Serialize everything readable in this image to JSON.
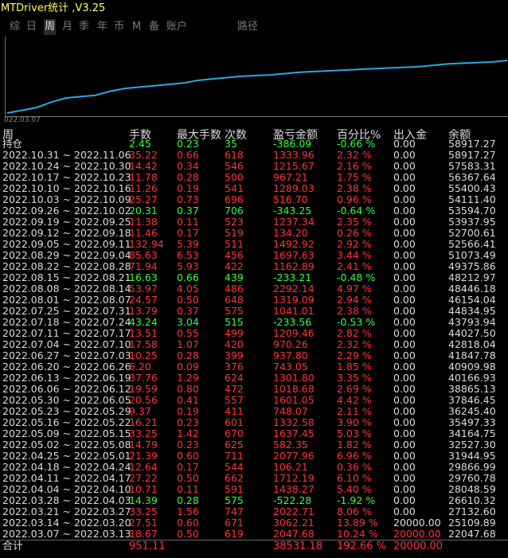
{
  "title": "MTDriver统计 ,V3.25",
  "tabs": [
    {
      "label": "综",
      "active": false
    },
    {
      "label": "日",
      "active": false
    },
    {
      "label": "周",
      "active": true
    },
    {
      "label": "月",
      "active": false
    },
    {
      "label": "季",
      "active": false
    },
    {
      "label": "年",
      "active": false
    },
    {
      "label": "币",
      "active": false
    },
    {
      "label": "M",
      "active": false
    },
    {
      "label": "备",
      "active": false
    },
    {
      "label": "账户",
      "active": false
    },
    {
      "label": "路径",
      "active": false
    }
  ],
  "chart": {
    "start_label": "022.03.07",
    "line_color": "#29a8e0",
    "values": [
      0,
      2,
      4,
      8,
      11,
      12,
      13,
      16,
      18,
      19,
      20,
      21,
      22,
      24,
      25,
      26,
      27,
      27.5,
      28,
      29,
      30,
      30.5,
      31,
      31.5,
      32,
      32.5,
      33,
      33.5,
      34,
      35,
      36,
      36.5,
      37,
      37.5,
      38.5
    ]
  },
  "headers": {
    "period": "周",
    "lots": "手数",
    "max_lots": "最大手数",
    "count": "次数",
    "profit": "盈亏金额",
    "percent": "百分比%",
    "inout": "出入金",
    "balance": "余额"
  },
  "position_row": {
    "label": "持仓",
    "lots": "2.45",
    "max": "0.23",
    "count": "35",
    "profit": "-386.09",
    "pct": "-0.66 %",
    "inout": "0.00",
    "balance": "58917.27"
  },
  "rows": [
    {
      "period": "2022.10.31 ~ 2022.11.06",
      "lots": "35.22",
      "max": "0.66",
      "count": "618",
      "profit": "1333.96",
      "pct": "2.32 %",
      "inout": "0.00",
      "balance": "58917.27",
      "pos": true
    },
    {
      "period": "2022.10.24 ~ 2022.10.30",
      "lots": "14.42",
      "max": "0.34",
      "count": "546",
      "profit": "1215.67",
      "pct": "2.16 %",
      "inout": "0.00",
      "balance": "57583.31",
      "pos": true
    },
    {
      "period": "2022.10.17 ~ 2022.10.23",
      "lots": "11.78",
      "max": "0.28",
      "count": "500",
      "profit": "967.21",
      "pct": "1.75 %",
      "inout": "0.00",
      "balance": "56367.64",
      "pos": true
    },
    {
      "period": "2022.10.10 ~ 2022.10.16",
      "lots": "11.26",
      "max": "0.19",
      "count": "541",
      "profit": "1289.03",
      "pct": "2.38 %",
      "inout": "0.00",
      "balance": "55400.43",
      "pos": true
    },
    {
      "period": "2022.10.03 ~ 2022.10.09",
      "lots": "25.27",
      "max": "0.73",
      "count": "696",
      "profit": "516.70",
      "pct": "0.96 %",
      "inout": "0.00",
      "balance": "54111.40",
      "pos": true
    },
    {
      "period": "2022.09.26 ~ 2022.10.02",
      "lots": "20.31",
      "max": "0.37",
      "count": "706",
      "profit": "-343.25",
      "pct": "-0.64 %",
      "inout": "0.00",
      "balance": "53594.70",
      "pos": false
    },
    {
      "period": "2022.09.19 ~ 2022.09.25",
      "lots": "11.38",
      "max": "0.11",
      "count": "523",
      "profit": "1237.34",
      "pct": "2.35 %",
      "inout": "0.00",
      "balance": "53937.95",
      "pos": true
    },
    {
      "period": "2022.09.12 ~ 2022.09.18",
      "lots": "11.46",
      "max": "0.17",
      "count": "519",
      "profit": "134.20",
      "pct": "0.26 %",
      "inout": "0.00",
      "balance": "52700.61",
      "pos": true
    },
    {
      "period": "2022.09.05 ~ 2022.09.11",
      "lots": "132.94",
      "max": "5.39",
      "count": "511",
      "profit": "1492.92",
      "pct": "2.92 %",
      "inout": "0.00",
      "balance": "52566.41",
      "pos": true
    },
    {
      "period": "2022.08.29 ~ 2022.09.04",
      "lots": "85.63",
      "max": "6.53",
      "count": "456",
      "profit": "1697.63",
      "pct": "3.44 %",
      "inout": "0.00",
      "balance": "51073.49",
      "pos": true
    },
    {
      "period": "2022.08.22 ~ 2022.08.28",
      "lots": "71.94",
      "max": "5.93",
      "count": "422",
      "profit": "1162.89",
      "pct": "2.41 %",
      "inout": "0.00",
      "balance": "49375.86",
      "pos": true
    },
    {
      "period": "2022.08.15 ~ 2022.08.21",
      "lots": "16.63",
      "max": "0.66",
      "count": "439",
      "profit": "-233.21",
      "pct": "-0.48 %",
      "inout": "0.00",
      "balance": "48212.97",
      "pos": false
    },
    {
      "period": "2022.08.08 ~ 2022.08.14",
      "lots": "53.97",
      "max": "4.05",
      "count": "486",
      "profit": "2292.14",
      "pct": "4.97 %",
      "inout": "0.00",
      "balance": "48446.18",
      "pos": true
    },
    {
      "period": "2022.08.01 ~ 2022.08.07",
      "lots": "24.57",
      "max": "0.50",
      "count": "648",
      "profit": "1319.09",
      "pct": "2.94 %",
      "inout": "0.00",
      "balance": "46154.04",
      "pos": true
    },
    {
      "period": "2022.07.25 ~ 2022.07.31",
      "lots": "13.79",
      "max": "0.37",
      "count": "575",
      "profit": "1041.01",
      "pct": "2.38 %",
      "inout": "0.00",
      "balance": "44834.95",
      "pos": true
    },
    {
      "period": "2022.07.18 ~ 2022.07.24",
      "lots": "43.24",
      "max": "3.04",
      "count": "515",
      "profit": "-233.56",
      "pct": "-0.53 %",
      "inout": "0.00",
      "balance": "43793.94",
      "pos": false
    },
    {
      "period": "2022.07.11 ~ 2022.07.17",
      "lots": "13.51",
      "max": "0.55",
      "count": "499",
      "profit": "1209.46",
      "pct": "2.82 %",
      "inout": "0.00",
      "balance": "44027.50",
      "pos": true
    },
    {
      "period": "2022.07.04 ~ 2022.07.10",
      "lots": "17.58",
      "max": "1.07",
      "count": "420",
      "profit": "970.26",
      "pct": "2.32 %",
      "inout": "0.00",
      "balance": "42818.04",
      "pos": true
    },
    {
      "period": "2022.06.27 ~ 2022.07.03",
      "lots": "10.25",
      "max": "0.28",
      "count": "399",
      "profit": "937.80",
      "pct": "2.29 %",
      "inout": "0.00",
      "balance": "41847.78",
      "pos": true
    },
    {
      "period": "2022.06.20 ~ 2022.06.26",
      "lots": "6.20",
      "max": "0.09",
      "count": "376",
      "profit": "743.05",
      "pct": "1.85 %",
      "inout": "0.00",
      "balance": "40909.98",
      "pos": true
    },
    {
      "period": "2022.06.13 ~ 2022.06.19",
      "lots": "37.76",
      "max": "1.29",
      "count": "624",
      "profit": "1301.80",
      "pct": "3.35 %",
      "inout": "0.00",
      "balance": "40166.93",
      "pos": true
    },
    {
      "period": "2022.06.06 ~ 2022.06.12",
      "lots": "19.59",
      "max": "0.80",
      "count": "472",
      "profit": "1018.68",
      "pct": "2.69 %",
      "inout": "0.00",
      "balance": "38865.13",
      "pos": true
    },
    {
      "period": "2022.05.30 ~ 2022.06.05",
      "lots": "20.56",
      "max": "0.41",
      "count": "557",
      "profit": "1601.05",
      "pct": "4.42 %",
      "inout": "0.00",
      "balance": "37846.45",
      "pos": true
    },
    {
      "period": "2022.05.23 ~ 2022.05.29",
      "lots": "9.37",
      "max": "0.19",
      "count": "411",
      "profit": "748.07",
      "pct": "2.11 %",
      "inout": "0.00",
      "balance": "36245.40",
      "pos": true
    },
    {
      "period": "2022.05.16 ~ 2022.05.22",
      "lots": "16.21",
      "max": "0.23",
      "count": "601",
      "profit": "1332.58",
      "pct": "3.90 %",
      "inout": "0.00",
      "balance": "35497.33",
      "pos": true
    },
    {
      "period": "2022.05.09 ~ 2022.05.15",
      "lots": "33.25",
      "max": "1.42",
      "count": "670",
      "profit": "1637.45",
      "pct": "5.03 %",
      "inout": "0.00",
      "balance": "34164.75",
      "pos": true
    },
    {
      "period": "2022.05.02 ~ 2022.05.08",
      "lots": "14.79",
      "max": "0.23",
      "count": "625",
      "profit": "582.35",
      "pct": "1.82 %",
      "inout": "0.00",
      "balance": "32527.30",
      "pos": true
    },
    {
      "period": "2022.04.25 ~ 2022.05.01",
      "lots": "21.39",
      "max": "0.60",
      "count": "711",
      "profit": "2077.96",
      "pct": "6.96 %",
      "inout": "0.00",
      "balance": "31944.95",
      "pos": true
    },
    {
      "period": "2022.04.18 ~ 2022.04.24",
      "lots": "12.64",
      "max": "0.17",
      "count": "544",
      "profit": "106.21",
      "pct": "0.36 %",
      "inout": "0.00",
      "balance": "29866.99",
      "pos": true
    },
    {
      "period": "2022.04.11 ~ 2022.04.17",
      "lots": "27.22",
      "max": "0.50",
      "count": "662",
      "profit": "1712.19",
      "pct": "6.10 %",
      "inout": "0.00",
      "balance": "29760.78",
      "pos": true
    },
    {
      "period": "2022.04.04 ~ 2022.04.10",
      "lots": "10.71",
      "max": "0.11",
      "count": "591",
      "profit": "1438.27",
      "pct": "5.40 %",
      "inout": "0.00",
      "balance": "28048.59",
      "pos": true
    },
    {
      "period": "2022.03.28 ~ 2022.04.03",
      "lots": "14.39",
      "max": "0.28",
      "count": "575",
      "profit": "-522.28",
      "pct": "-1.92 %",
      "inout": "0.00",
      "balance": "26610.32",
      "pos": false
    },
    {
      "period": "2022.03.21 ~ 2022.03.27",
      "lots": "33.25",
      "max": "1.56",
      "count": "747",
      "profit": "2022.71",
      "pct": "8.06 %",
      "inout": "0.00",
      "balance": "27132.60",
      "pos": true
    },
    {
      "period": "2022.03.14 ~ 2022.03.20",
      "lots": "27.51",
      "max": "0.60",
      "count": "671",
      "profit": "3062.21",
      "pct": "13.89 %",
      "inout": "20000.00",
      "balance": "25109.89",
      "pos": true
    },
    {
      "period": "2022.03.07 ~ 2022.03.13",
      "lots": "18.67",
      "max": "0.50",
      "count": "619",
      "profit": "2047.68",
      "pct": "10.24 %",
      "inout": "20000.00",
      "balance": "22047.68",
      "pos": true,
      "red_inout": true
    }
  ],
  "summary": {
    "label": "合计",
    "lots": "951.11",
    "profit": "38531.18",
    "pct": "192.66 %",
    "inout": "20000.00"
  }
}
